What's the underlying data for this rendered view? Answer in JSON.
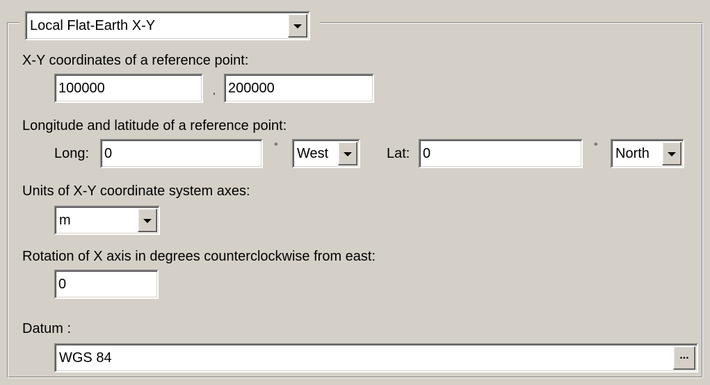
{
  "projection": {
    "selected": "Local Flat-Earth X-Y"
  },
  "reference_xy": {
    "label": "X-Y coordinates of a reference point:",
    "x_value": "100000",
    "separator": ",",
    "y_value": "200000"
  },
  "reference_lonlat": {
    "label": "Longitude and latitude of a reference point:",
    "long_label": "Long:",
    "long_value": "0",
    "long_degree_symbol": "°",
    "long_hemisphere": "West",
    "lat_label": "Lat:",
    "lat_value": "0",
    "lat_degree_symbol": "°",
    "lat_hemisphere": "North"
  },
  "units": {
    "label": "Units of X-Y coordinate system axes:",
    "selected": "m"
  },
  "rotation": {
    "label": "Rotation of X axis in degrees counterclockwise from east:",
    "value": "0"
  },
  "datum": {
    "label": "Datum :",
    "value": "WGS 84",
    "browse_label": "..."
  },
  "icons": {
    "dropdown": "chevron-down-icon",
    "browse": "ellipsis-icon"
  }
}
